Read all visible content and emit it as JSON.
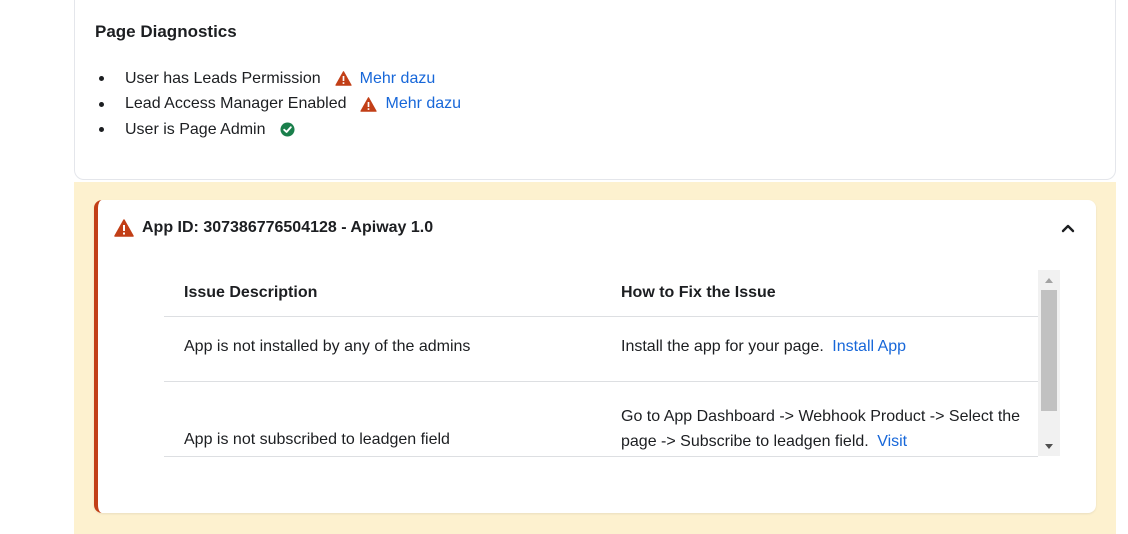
{
  "diagnostics": {
    "title": "Page Diagnostics",
    "items": [
      {
        "label": "User has Leads Permission",
        "status": "warning",
        "link": "Mehr dazu"
      },
      {
        "label": "Lead Access Manager Enabled",
        "status": "warning",
        "link": "Mehr dazu"
      },
      {
        "label": "User is Page Admin",
        "status": "ok"
      }
    ]
  },
  "app": {
    "title": "App ID: 307386776504128 - Apiway 1.0",
    "table": {
      "headers": [
        "Issue Description",
        "How to Fix the Issue"
      ],
      "rows": [
        {
          "issue": "App is not installed by any of the admins",
          "fix_text": "Install the app for your page.",
          "fix_link": "Install App"
        },
        {
          "issue": "App is not subscribed to leadgen field",
          "fix_text": "Go to App Dashboard -> Webhook Product -> Select the page -> Subscribe to leadgen field.",
          "fix_link": "Visit"
        }
      ]
    }
  },
  "colors": {
    "warning": "#c23f17",
    "success": "#1a7f4b",
    "link": "#1767d9",
    "highlight_bg": "#fdf1cf"
  }
}
